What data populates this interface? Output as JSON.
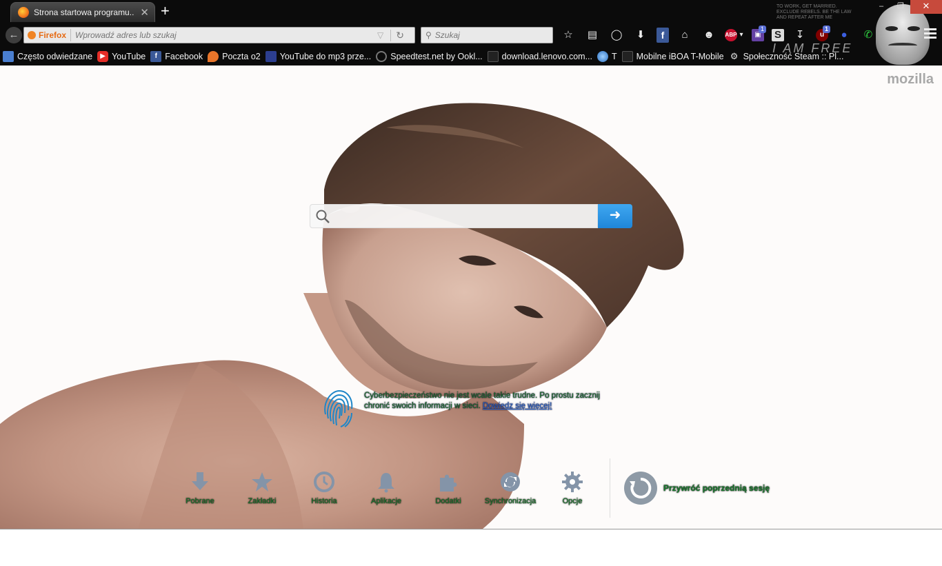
{
  "window": {
    "controls": [
      "–",
      "❐",
      "✕"
    ]
  },
  "tab": {
    "title": "Strona startowa programu...",
    "close": "✕",
    "new_tab": "+"
  },
  "navbar": {
    "identity": "Firefox",
    "url_placeholder": "Wprowadź adres lub szukaj",
    "search_placeholder": "Szukaj",
    "extension_badges": {
      "twitch": "1",
      "ublock": "1"
    }
  },
  "bookmarks": [
    {
      "label": "Często odwiedzane",
      "icon": "folder-icon",
      "color": "#4a7fd0"
    },
    {
      "label": "YouTube",
      "icon": "youtube-icon",
      "color": "#e52d27"
    },
    {
      "label": "Facebook",
      "icon": "facebook-icon",
      "color": "#3b5998"
    },
    {
      "label": "Poczta o2",
      "icon": "balloon-icon",
      "color": "#e8752a"
    },
    {
      "label": "YouTube do mp3 prze...",
      "icon": "yt-mp3-icon",
      "color": "#2c3e8f"
    },
    {
      "label": "Speedtest.net by Ookl...",
      "icon": "speedtest-icon",
      "color": "#333333"
    },
    {
      "label": "download.lenovo.com...",
      "icon": "page-icon",
      "color": "#333333"
    },
    {
      "label": "T",
      "icon": "globe-icon",
      "color": "#4a8fd0"
    },
    {
      "label": "Mobilne iBOA T-Mobile",
      "icon": "page-icon",
      "color": "#333333"
    },
    {
      "label": "Społeczność Steam :: Pl...",
      "icon": "steam-icon",
      "color": "#cccccc"
    }
  ],
  "theme": {
    "text": "I AM FREE",
    "small": "TO WORK, GET MARRIED. EXCLUDE REBELS. BE THE LAW AND REPEAT AFTER ME"
  },
  "page": {
    "brand": "mozilla",
    "snippet_text": "Cyberbezpieczeństwo nie jest wcale takie trudne. Po prostu zacznij chronić swoich informacji w sieci.",
    "snippet_link": "Dowiedz się więcej!",
    "launcher": [
      {
        "label": "Pobrane",
        "icon": "download-icon"
      },
      {
        "label": "Zakładki",
        "icon": "star-icon"
      },
      {
        "label": "Historia",
        "icon": "clock-icon"
      },
      {
        "label": "Aplikacje",
        "icon": "bell-icon"
      },
      {
        "label": "Dodatki",
        "icon": "puzzle-icon"
      },
      {
        "label": "Synchronizacja",
        "icon": "sync-icon"
      },
      {
        "label": "Opcje",
        "icon": "gear-icon"
      }
    ],
    "restore_label": "Przywróć poprzednią sesję"
  },
  "colors": {
    "accent": "#1f86d9",
    "label_text": "#1a7a2e"
  }
}
